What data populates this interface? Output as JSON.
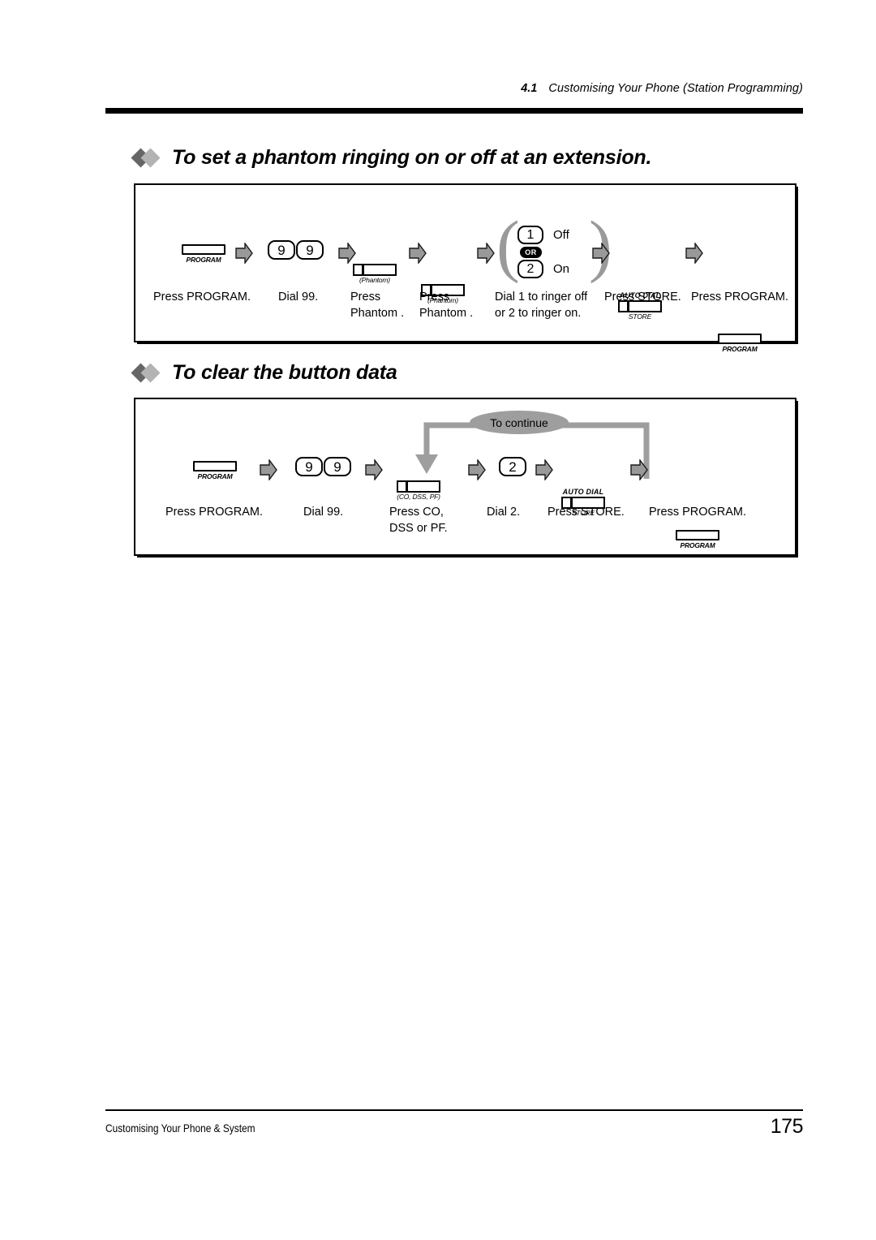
{
  "header": {
    "section_number": "4.1",
    "section_title": "Customising Your Phone (Station Programming)"
  },
  "sections": [
    {
      "id": "phantom-ringing",
      "title": "To set a phantom ringing on or off at an extension.",
      "steps": [
        {
          "kind": "program-button",
          "button_label": "PROGRAM",
          "caption": "Press PROGRAM."
        },
        {
          "kind": "keys",
          "keys": [
            "9",
            "9"
          ],
          "caption": "Dial 99."
        },
        {
          "kind": "flex-button",
          "sub_label": "(Phantom)",
          "caption": "Press\nPhantom ."
        },
        {
          "kind": "flex-button",
          "sub_label": "(Phantom)",
          "caption": "Press\nPhantom ."
        },
        {
          "kind": "choice",
          "options": [
            {
              "key": "1",
              "label": "Off"
            },
            {
              "key": "2",
              "label": "On"
            }
          ],
          "separator": "OR",
          "caption": "Dial 1 to ringer off\nor 2 to ringer on."
        },
        {
          "kind": "store-button",
          "sup_label": "AUTO DIAL",
          "sub_label": "STORE",
          "caption": "Press STORE."
        },
        {
          "kind": "program-button",
          "button_label": "PROGRAM",
          "caption": "Press PROGRAM."
        }
      ]
    },
    {
      "id": "clear-button-data",
      "title": "To clear the button data",
      "loop_label": "To continue",
      "steps": [
        {
          "kind": "program-button",
          "button_label": "PROGRAM",
          "caption": "Press PROGRAM."
        },
        {
          "kind": "keys",
          "keys": [
            "9",
            "9"
          ],
          "caption": "Dial 99."
        },
        {
          "kind": "flex-button",
          "sub_label": "(CO, DSS, PF)",
          "caption": "Press CO,\nDSS or PF."
        },
        {
          "kind": "keys",
          "keys": [
            "2"
          ],
          "caption": "Dial 2."
        },
        {
          "kind": "store-button",
          "sup_label": "AUTO DIAL",
          "sub_label": "STORE",
          "caption": "Press STORE."
        },
        {
          "kind": "program-button",
          "button_label": "PROGRAM",
          "caption": "Press PROGRAM."
        }
      ]
    }
  ],
  "footer": {
    "left": "Customising Your Phone & System",
    "page_number": "175"
  },
  "colors": {
    "arrow_fill": "#999999",
    "arrow_stroke": "#1a1a1a",
    "diamond_dark": "#666666",
    "diamond_light": "#b3b3b3",
    "ellipse_fill": "#9e9e9e",
    "loop_arrow": "#9e9e9e"
  }
}
